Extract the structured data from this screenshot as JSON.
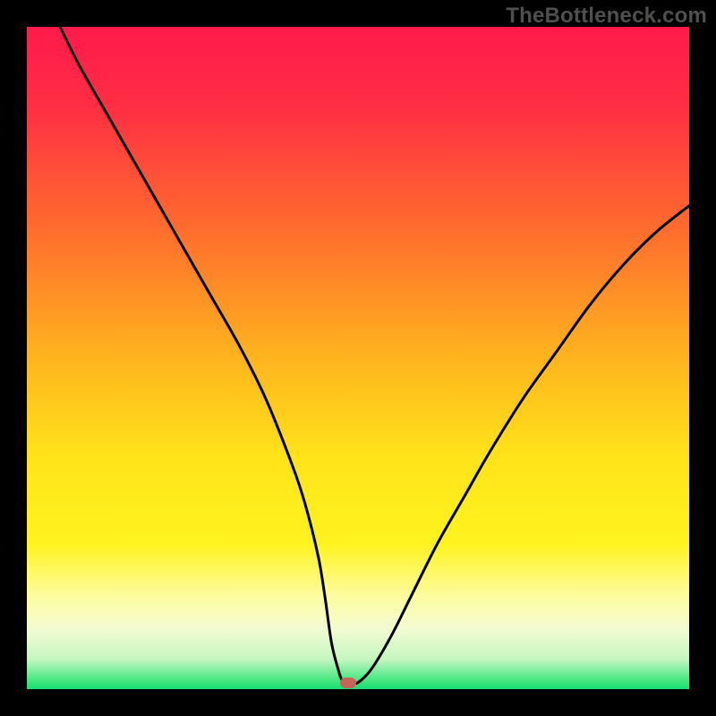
{
  "watermark": "TheBottleneck.com",
  "colors": {
    "background": "#000000",
    "curve": "#000000",
    "marker": "#c86357",
    "gradient_stops": [
      {
        "offset": 0.0,
        "color": "#ff1a4b"
      },
      {
        "offset": 0.12,
        "color": "#ff2e44"
      },
      {
        "offset": 0.3,
        "color": "#ff6a2e"
      },
      {
        "offset": 0.5,
        "color": "#ffb41e"
      },
      {
        "offset": 0.65,
        "color": "#ffe31a"
      },
      {
        "offset": 0.78,
        "color": "#fff31e"
      },
      {
        "offset": 0.86,
        "color": "#fdfca0"
      },
      {
        "offset": 0.91,
        "color": "#f3fbd2"
      },
      {
        "offset": 0.955,
        "color": "#c4f6c0"
      },
      {
        "offset": 0.985,
        "color": "#4be883"
      },
      {
        "offset": 1.0,
        "color": "#18df72"
      }
    ]
  },
  "chart_data": {
    "type": "line",
    "title": "",
    "xlabel": "",
    "ylabel": "",
    "xlim": [
      0,
      100
    ],
    "ylim": [
      0,
      100
    ],
    "series": [
      {
        "name": "bottleneck-curve",
        "x": [
          5,
          8,
          12,
          16,
          20,
          24,
          28,
          32,
          36,
          40,
          42,
          44,
          45,
          46,
          47,
          47.5,
          48,
          49,
          50,
          52,
          55,
          58,
          62,
          66,
          70,
          75,
          80,
          85,
          90,
          95,
          100
        ],
        "y": [
          100,
          94,
          87,
          80,
          73,
          66,
          59,
          52,
          44,
          34,
          28,
          20,
          14,
          7,
          3,
          1.5,
          1,
          1,
          1,
          3,
          8,
          14,
          22,
          29,
          36,
          44,
          51,
          58,
          64,
          69,
          73
        ]
      }
    ],
    "marker": {
      "x": 48.5,
      "y": 1
    },
    "annotations": []
  }
}
